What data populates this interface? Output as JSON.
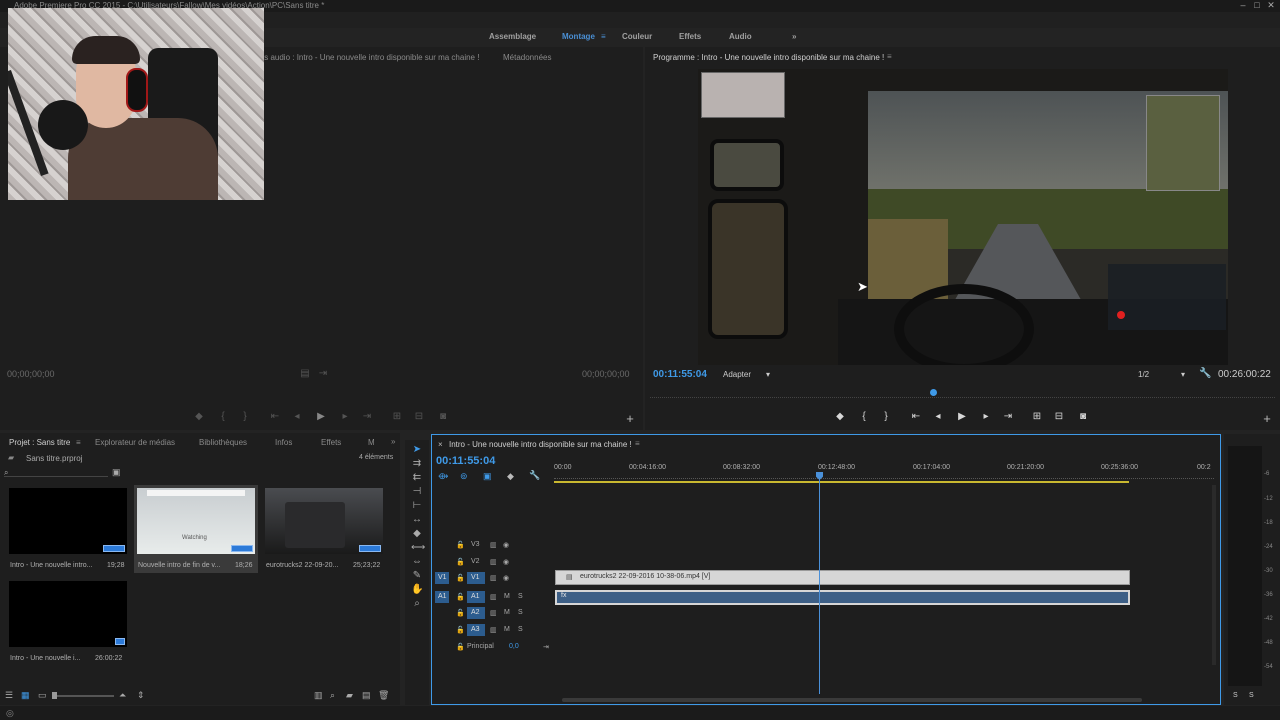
{
  "window": {
    "title": "Adobe Premiere Pro CC 2015 - C:\\Utilisateurs\\Fallow\\Mes vidéos\\Action\\PC\\Sans titre *"
  },
  "workspaces": [
    {
      "label": "Assemblage"
    },
    {
      "label": "Montage"
    },
    {
      "label": "Couleur"
    },
    {
      "label": "Effets"
    },
    {
      "label": "Audio"
    },
    {
      "label": "»"
    }
  ],
  "source_panel": {
    "tab_audio": "ts audio : Intro - Une nouvelle intro disponible sur ma chaine !",
    "tab_meta": "Métadonnées",
    "tc_left": "00;00;00;00",
    "tc_right": "00;00;00;00"
  },
  "program_panel": {
    "title": "Programme : Intro - Une nouvelle intro disponible sur ma chaine !",
    "menu": "≡",
    "tc_current": "00:11:55:04",
    "fit": "Adapter",
    "resolution": "1/2",
    "tc_duration": "00:26:00:22"
  },
  "project_panel": {
    "tabs": [
      {
        "label": "Projet : Sans titre"
      },
      {
        "label": "Explorateur de médias"
      },
      {
        "label": "Bibliothèques"
      },
      {
        "label": "Infos"
      },
      {
        "label": "Effets"
      },
      {
        "label": "M"
      },
      {
        "label": "»"
      }
    ],
    "file": "Sans titre.prproj",
    "count": "4 éléments",
    "items": [
      {
        "name": "Intro - Une nouvelle intro...",
        "dur": "19;28"
      },
      {
        "name": "Nouvelle intro de fin de v...",
        "dur": "18;26",
        "watermark": "Watching"
      },
      {
        "name": "eurotrucks2 22-09-20...",
        "dur": "25;23;22"
      },
      {
        "name": "Intro - Une nouvelle i...",
        "dur": "26:00:22"
      }
    ]
  },
  "timeline": {
    "title": "Intro - Une nouvelle intro disponible sur ma chaine !",
    "tc": "00:11:55:04",
    "ruler": [
      "00:00",
      "00:04:16:00",
      "00:08:32:00",
      "00:12:48:00",
      "00:17:04:00",
      "00:21:20:00",
      "00:25:36:00",
      "00:2"
    ],
    "video_tracks": [
      "V3",
      "V2",
      "V1"
    ],
    "audio_tracks": [
      "A1",
      "A2",
      "A3"
    ],
    "source_v": "V1",
    "source_a": "A1",
    "master": {
      "label": "Principal",
      "value": "0,0"
    },
    "video_clip": "eurotrucks2 22-09-2016 10-38-06.mp4 [V]",
    "audio_clip": "fx",
    "playhead_fraction": 0.459
  },
  "meters": {
    "labels": [
      "-6",
      "-12",
      "-18",
      "-24",
      "-30",
      "-36",
      "-42",
      "-48",
      "-54"
    ],
    "bottom": [
      "S",
      "S"
    ]
  },
  "colors": {
    "accent": "#3f9ae8",
    "clip_video": "#d6d6d6",
    "clip_audio": "#3d5f86"
  }
}
